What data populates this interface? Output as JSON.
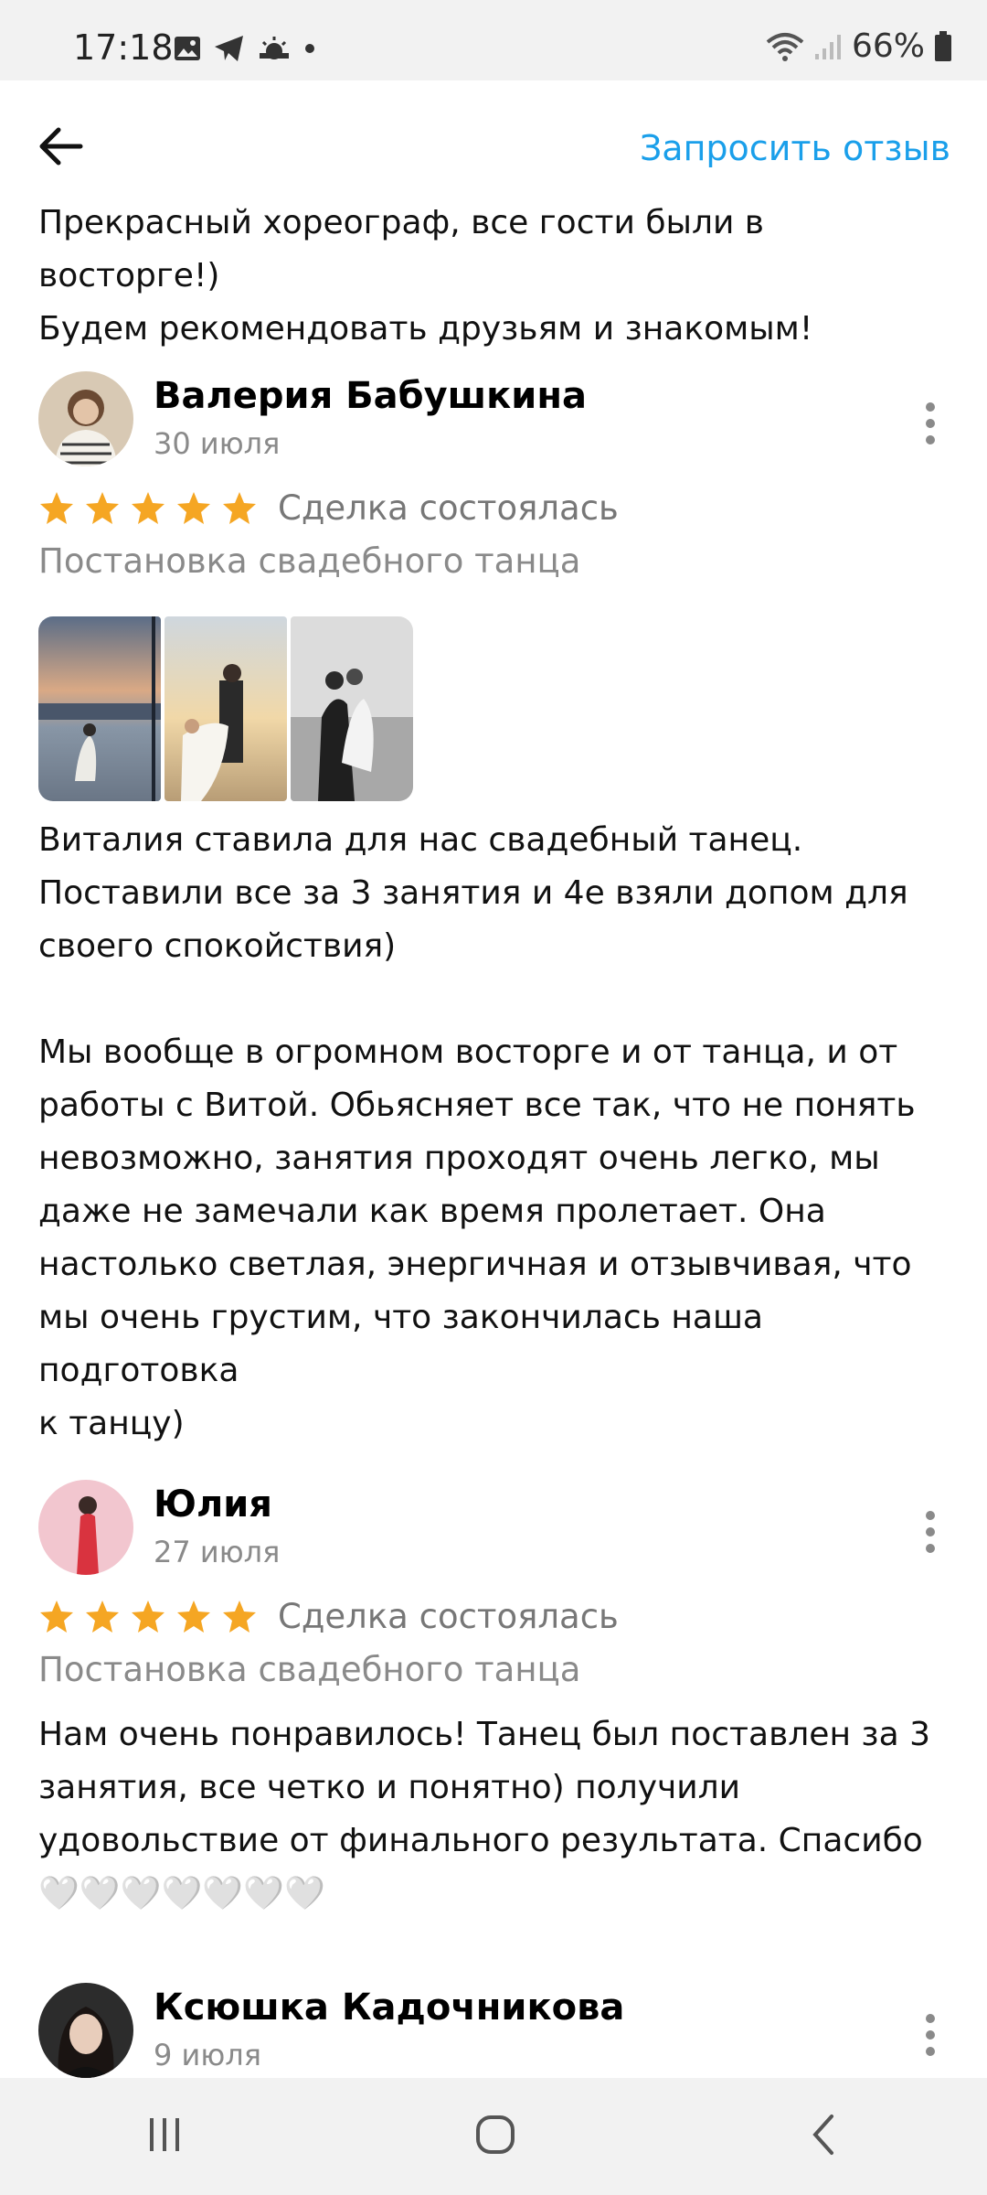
{
  "status_bar": {
    "time": "17:18",
    "battery": "66%",
    "icons": [
      "image-icon",
      "telegram-icon",
      "weather-icon",
      "dot-icon",
      "wifi-icon",
      "signal-icon",
      "battery-icon"
    ]
  },
  "header": {
    "back_icon": "arrow-left-icon",
    "request_review": "Запросить отзыв"
  },
  "top_text": "Прекрасный хореограф, все гости были в восторге!)\nБудем рекомендовать друзьям и знакомым!",
  "reviews": [
    {
      "author": "Валерия Бабушкина",
      "date": "30 июля",
      "rating": 5,
      "deal_status": "Сделка состоялась",
      "service": "Постановка свадебного танца",
      "text": "Виталия ставила для нас свадебный танец.\nПоставили все за 3 занятия и 4е взяли допом для\nсвоего спокойствия)\n\nМы вообще в огромном восторге и от танца, и от\nработы с Витой. Обьясняет все так, что не понять\nневозможно, занятия проходят очень легко, мы\nдаже не замечали как время пролетает.  Она\nнастолько светлая, энергичная и отзывчивая, что\nмы очень грустим, что закончилась наша подготовка\nк танцу)"
    },
    {
      "author": "Юлия",
      "date": "27 июля",
      "rating": 5,
      "deal_status": "Сделка состоялась",
      "service": "Постановка свадебного танца",
      "text": "Нам очень понравилось! Танец был поставлен за 3\nзанятия, все четко и понятно) получили\nудовольствие от финального результата. Спасибо\n🤍🤍🤍🤍🤍🤍🤍"
    },
    {
      "author": "Ксюшка Кадочникова",
      "date": "9 июля"
    }
  ],
  "colors": {
    "accent": "#1a9fea",
    "star": "#f5a623",
    "secondary_text": "#8a8a8a"
  }
}
